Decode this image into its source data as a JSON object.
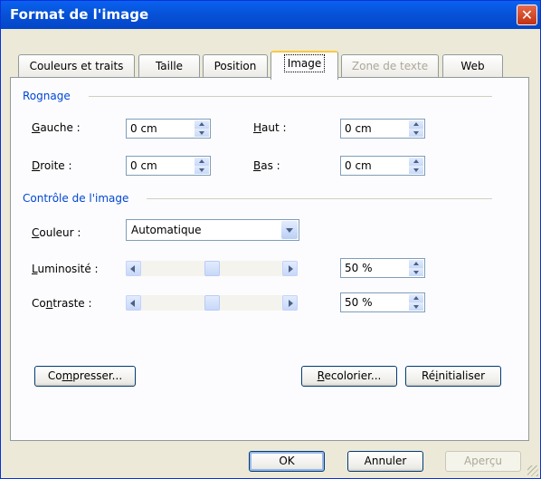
{
  "window": {
    "title": "Format de l'image",
    "close_label": "✕"
  },
  "tabs": [
    {
      "label": "Couleurs et traits"
    },
    {
      "label": "Taille"
    },
    {
      "label": "Position"
    },
    {
      "label": "Image",
      "active": true
    },
    {
      "label": "Zone de texte",
      "disabled": true
    },
    {
      "label": "Web"
    }
  ],
  "crop": {
    "heading": "Rognage",
    "left": {
      "mnemonic": "G",
      "rest": "auche :",
      "value": "0 cm"
    },
    "top": {
      "mnemonic": "H",
      "rest": "aut :",
      "value": "0 cm"
    },
    "right": {
      "mnemonic": "D",
      "rest": "roite :",
      "value": "0 cm"
    },
    "bottom": {
      "mnemonic": "B",
      "rest": "as :",
      "value": "0 cm"
    }
  },
  "image_control": {
    "heading": "Contrôle de l'image",
    "color": {
      "mnemonic": "C",
      "rest": "ouleur :",
      "value": "Automatique"
    },
    "brightness": {
      "mnemonic": "L",
      "rest": "uminosité :",
      "value": "50 %",
      "level": 0.5
    },
    "contrast": {
      "pre": "Co",
      "mnemonic": "n",
      "rest": "traste :",
      "value": "50 %",
      "level": 0.5
    }
  },
  "buttons": {
    "compress": {
      "pre": "Co",
      "mnemonic": "m",
      "rest": "presser..."
    },
    "recolor": {
      "mnemonic": "R",
      "rest": "ecolorier..."
    },
    "reset": {
      "pre": "Ré",
      "mnemonic": "i",
      "rest": "nitialiser"
    },
    "ok": "OK",
    "cancel": "Annuler",
    "preview": "Aperçu"
  },
  "colors": {
    "accent": "#0046D5",
    "titlebar": "#0A62F0",
    "face": "#ECE9D8"
  }
}
